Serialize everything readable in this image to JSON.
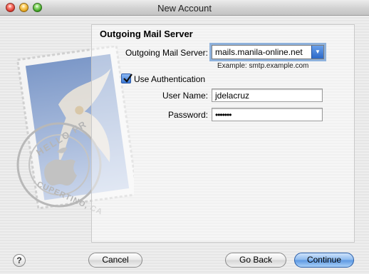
{
  "window": {
    "title": "New Account"
  },
  "section": {
    "title": "Outgoing Mail Server"
  },
  "smtp": {
    "label": "Outgoing Mail Server:",
    "value": "mails.manila-online.net",
    "hint": "Example: smtp.example.com"
  },
  "auth": {
    "checkbox_label": "Use Authentication",
    "checked": true,
    "username_label": "User Name:",
    "username_value": "jdelacruz",
    "password_label": "Password:",
    "password_value": "•••••••"
  },
  "postmark": {
    "line1": "HELLO FR",
    "line2": "CUPERTINO, CA"
  },
  "buttons": {
    "help": "?",
    "cancel": "Cancel",
    "go_back": "Go Back",
    "continue": "Continue"
  }
}
